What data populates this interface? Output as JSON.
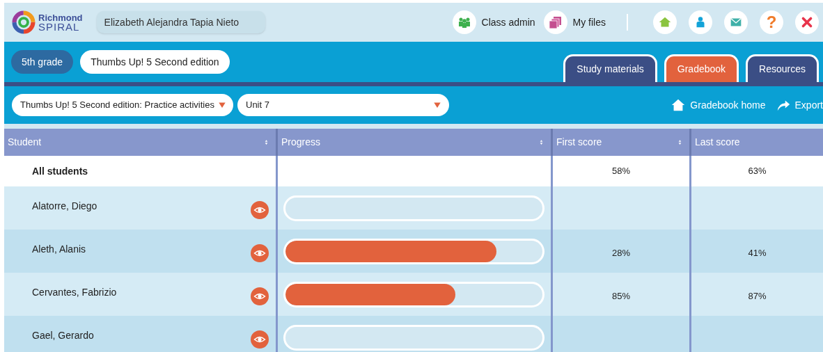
{
  "header": {
    "logo_line1": "Richmond",
    "logo_line2": "SPIRAL",
    "user_name": "Elizabeth Alejandra Tapia Nieto",
    "links": [
      {
        "kind": "class",
        "label": "Class admin"
      },
      {
        "kind": "files",
        "label": "My files"
      }
    ],
    "icon_buttons": [
      {
        "kind": "home"
      },
      {
        "kind": "profile"
      },
      {
        "kind": "mail"
      },
      {
        "kind": "help",
        "glyph": "?"
      },
      {
        "kind": "close"
      }
    ]
  },
  "course_bar": {
    "grade": "5th grade",
    "course": "Thumbs Up! 5 Second edition"
  },
  "tabs": [
    {
      "label": "Study materials",
      "selected": false
    },
    {
      "label": "Gradebook",
      "selected": true
    },
    {
      "label": "Resources",
      "selected": false
    }
  ],
  "filters": [
    {
      "value": "Thumbs Up! 5 Second edition: Practice activities"
    },
    {
      "value": "Unit 7"
    }
  ],
  "actions": [
    {
      "kind": "home",
      "label": "Gradebook home"
    },
    {
      "kind": "export",
      "label": "Export"
    }
  ],
  "table": {
    "columns": [
      {
        "label": "Student",
        "sortable": true
      },
      {
        "label": "Progress",
        "sortable": true
      },
      {
        "label": "First score",
        "sortable": true
      },
      {
        "label": "Last score",
        "sortable": false
      }
    ],
    "summary": {
      "student": "All students",
      "first_score": "58%",
      "last_score": "63%"
    },
    "rows": [
      {
        "student": "Alatorre, Diego",
        "level": 0
      },
      {
        "student": "Aleth, Alanis",
        "level": 0.82,
        "first_score": "28%",
        "last_score": "41%"
      },
      {
        "student": "Cervantes, Fabrizio",
        "level": 0.66,
        "first_score": "85%",
        "last_score": "87%"
      },
      {
        "student": "Gael, Gerardo",
        "level": 0
      }
    ]
  }
}
